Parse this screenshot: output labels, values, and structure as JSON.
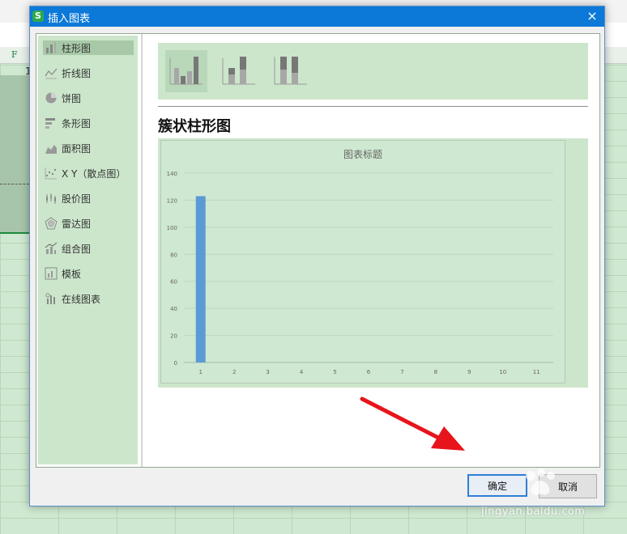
{
  "sheet": {
    "column_label": "F",
    "row_digit": "1"
  },
  "dialog": {
    "title": "插入图表",
    "app_icon": "S",
    "close_glyph": "×",
    "sidebar": [
      {
        "label": "柱形图",
        "icon": "column-chart-icon",
        "active": true
      },
      {
        "label": "折线图",
        "icon": "line-chart-icon"
      },
      {
        "label": "饼图",
        "icon": "pie-chart-icon"
      },
      {
        "label": "条形图",
        "icon": "bar-chart-icon"
      },
      {
        "label": "面积图",
        "icon": "area-chart-icon"
      },
      {
        "label": "X Y（散点图）",
        "icon": "scatter-chart-icon"
      },
      {
        "label": "股价图",
        "icon": "stock-chart-icon"
      },
      {
        "label": "雷达图",
        "icon": "radar-chart-icon"
      },
      {
        "label": "组合图",
        "icon": "combo-chart-icon"
      },
      {
        "label": "模板",
        "icon": "template-icon"
      },
      {
        "label": "在线图表",
        "icon": "online-chart-icon"
      }
    ],
    "subtypes": [
      "clustered-column",
      "stacked-column",
      "percent-stacked-column"
    ],
    "heading": "簇状柱形图",
    "ok_label": "确定",
    "cancel_label": "取消"
  },
  "chart_data": {
    "type": "bar",
    "title": "图表标题",
    "categories": [
      "1",
      "2",
      "3",
      "4",
      "5",
      "6",
      "7",
      "8",
      "9",
      "10",
      "11"
    ],
    "series": [
      {
        "values": [
          123,
          0,
          0,
          0,
          0,
          0,
          0,
          0,
          0,
          0,
          0
        ]
      }
    ],
    "ylim": [
      0,
      140
    ],
    "yticks": [
      0,
      20,
      40,
      60,
      80,
      100,
      120,
      140
    ],
    "grid": true,
    "bar_color": "#5b9bd5"
  },
  "watermark": {
    "text": "jingyan.baidu.com"
  }
}
